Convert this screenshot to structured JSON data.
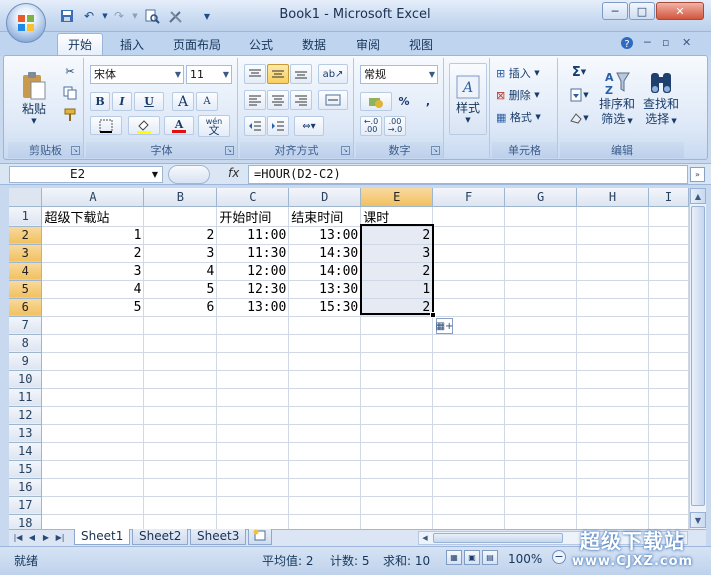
{
  "window": {
    "title": "Book1 - Microsoft Excel",
    "minimize": "─",
    "maximize": "□",
    "close": "✕"
  },
  "quick_access": {
    "save_icon": "save-icon",
    "undo_icon": "undo-icon",
    "redo_icon": "redo-icon",
    "preview_icon": "print-preview-icon",
    "tools_icon": "tools-icon",
    "customize_icon": "customize-icon"
  },
  "tabs": [
    "开始",
    "插入",
    "页面布局",
    "公式",
    "数据",
    "审阅",
    "视图"
  ],
  "ribbon": {
    "clipboard": {
      "label": "剪贴板",
      "paste": "粘贴"
    },
    "font": {
      "label": "字体",
      "name": "宋体",
      "size": "11",
      "bold": "B",
      "italic": "I",
      "underline": "U",
      "grow": "A",
      "shrink": "A",
      "color_a": "A",
      "phonetic": "wén"
    },
    "alignment": {
      "label": "对齐方式"
    },
    "number": {
      "label": "数字",
      "format": "常规",
      "percent": "%",
      "comma": ","
    },
    "styles": {
      "label": "样式"
    },
    "cells": {
      "label": "单元格",
      "insert": "插入",
      "delete": "删除",
      "format": "格式"
    },
    "editing": {
      "label": "编辑",
      "sigma": "Σ",
      "sort_filter": "排序和",
      "sort_filter2": "筛选",
      "find_select": "查找和",
      "find_select2": "选择"
    }
  },
  "formula_bar": {
    "name_box": "E2",
    "fx": "fx",
    "formula": "=HOUR(D2-C2)"
  },
  "grid": {
    "columns": [
      "A",
      "B",
      "C",
      "D",
      "E",
      "F",
      "G",
      "H",
      "I"
    ],
    "rows": [
      "1",
      "2",
      "3",
      "4",
      "5",
      "6",
      "7",
      "8",
      "9",
      "10",
      "11",
      "12",
      "13",
      "14",
      "15",
      "16",
      "17",
      "18"
    ],
    "cells": [
      [
        "超级下载站",
        "",
        "开始时间",
        "结束时间",
        "课时"
      ],
      [
        "1",
        "2",
        "11:00",
        "13:00",
        "2"
      ],
      [
        "2",
        "3",
        "11:30",
        "14:30",
        "3"
      ],
      [
        "3",
        "4",
        "12:00",
        "14:00",
        "2"
      ],
      [
        "4",
        "5",
        "12:30",
        "13:30",
        "1"
      ],
      [
        "5",
        "6",
        "13:00",
        "15:30",
        "2"
      ]
    ]
  },
  "sheets": [
    "Sheet1",
    "Sheet2",
    "Sheet3"
  ],
  "status": {
    "ready": "就绪",
    "average": "平均值: 2",
    "count": "计数: 5",
    "sum": "求和: 10",
    "zoom": "100%"
  },
  "watermark": {
    "line1": "超级下载站",
    "line2": "www.CJXZ.com"
  }
}
